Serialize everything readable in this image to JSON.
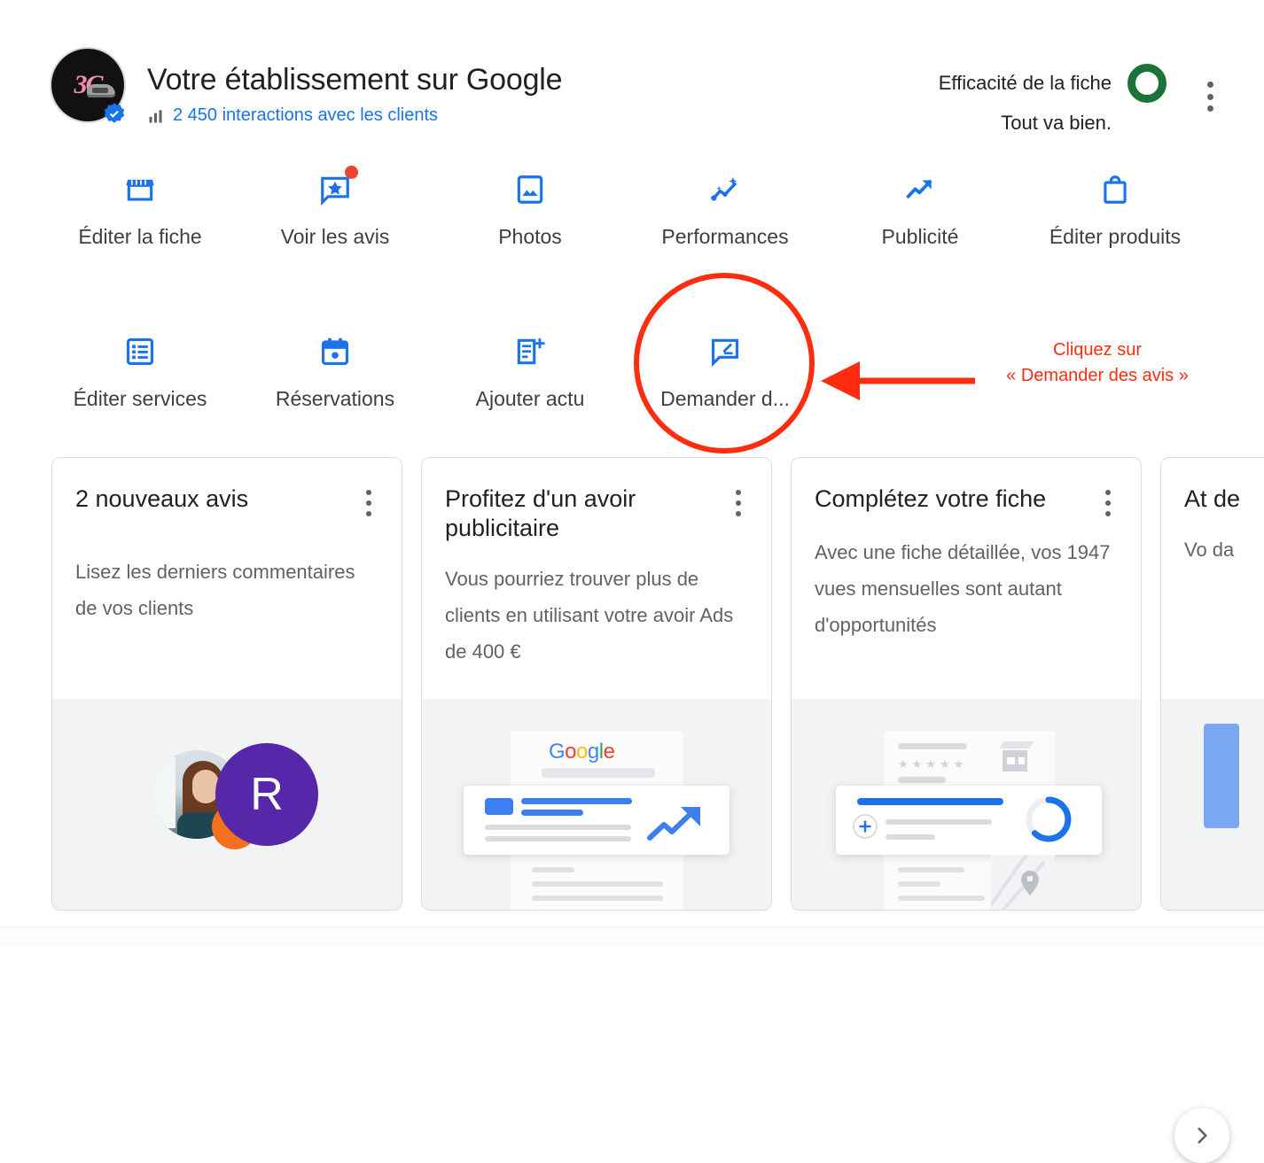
{
  "header": {
    "title": "Votre établissement sur Google",
    "interactions_label": "2 450 interactions avec les clients",
    "bars_icon": "bar-chart-icon",
    "verified_icon": "verified-badge-icon",
    "avatar_logo_text": "3C",
    "efficacy_label": "Efficacité de la fiche",
    "efficacy_status": "Tout va bien.",
    "efficacy_ring_color": "#1b7339",
    "overflow_icon": "more-vertical-icon"
  },
  "actions": {
    "row1": [
      {
        "label": "Éditer la fiche",
        "icon": "storefront-icon",
        "badge": false
      },
      {
        "label": "Voir les avis",
        "icon": "review-star-icon",
        "badge": true
      },
      {
        "label": "Photos",
        "icon": "photo-icon",
        "badge": false
      },
      {
        "label": "Performances",
        "icon": "insights-icon",
        "badge": false
      },
      {
        "label": "Publicité",
        "icon": "trending-up-icon",
        "badge": false
      },
      {
        "label": "Éditer produits",
        "icon": "shopping-bag-icon",
        "badge": false
      }
    ],
    "row2": [
      {
        "label": "Éditer services",
        "icon": "list-alt-icon",
        "badge": false
      },
      {
        "label": "Réservations",
        "icon": "calendar-icon",
        "badge": false
      },
      {
        "label": "Ajouter actu",
        "icon": "post-add-icon",
        "badge": false
      },
      {
        "label": "Demander d...",
        "icon": "request-review-icon",
        "badge": false
      }
    ]
  },
  "annotation": {
    "line1": "Cliquez sur",
    "line2": "« Demander des avis »",
    "color": "#ff2d10",
    "highlight_shape": "circle",
    "arrow": "left-arrow"
  },
  "cards": [
    {
      "title": "2 nouveaux avis",
      "body": "Lisez les derniers commentaires de vos clients",
      "menu_icon": "more-vertical-icon",
      "illustration": "reviewer-avatars",
      "avatar_initial": "R",
      "avatar_color": "#5627a8"
    },
    {
      "title": "Profitez d'un avoir publicitaire",
      "body": "Vous pourriez trouver plus de clients en utilisant votre avoir Ads de 400 €",
      "menu_icon": "more-vertical-icon",
      "illustration": "google-ads-growth",
      "brand_text": "Google"
    },
    {
      "title": "Complétez votre fiche",
      "body": "Avec une fiche détaillée, vos 1947 vues mensuelles sont autant d'opportunités",
      "menu_icon": "more-vertical-icon",
      "illustration": "profile-completion"
    },
    {
      "title_clipped": "At de",
      "body_clipped": "Vo da",
      "menu_icon": "more-vertical-icon",
      "illustration": "clipped-card"
    }
  ],
  "carousel": {
    "next_icon": "chevron-right-icon"
  }
}
